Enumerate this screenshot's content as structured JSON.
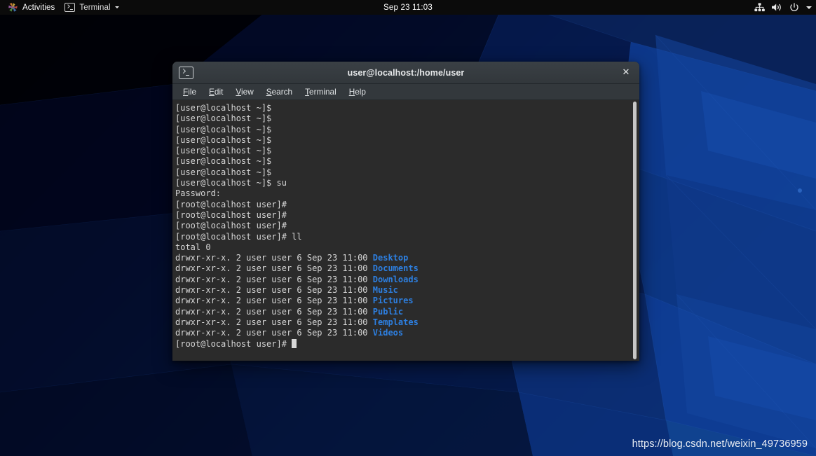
{
  "topbar": {
    "activities_label": "Activities",
    "activities_icon": "pinwheel-icon",
    "app_menu_label": "Terminal",
    "app_menu_icon": "terminal-icon",
    "app_menu_caret": "chevron-down-icon",
    "clock": "Sep 23  11:03",
    "status_icons": [
      "network-wired-icon",
      "volume-icon",
      "power-icon",
      "chevron-down-icon"
    ],
    "background_color": "#0b0b0b"
  },
  "window": {
    "title": "user@localhost:/home/user",
    "icon": "terminal-icon",
    "close_label": "✕",
    "titlebar_color": "#32373b",
    "menu": [
      {
        "label": "File",
        "mnemonic": "F",
        "rest": "ile"
      },
      {
        "label": "Edit",
        "mnemonic": "E",
        "rest": "dit"
      },
      {
        "label": "View",
        "mnemonic": "V",
        "rest": "iew"
      },
      {
        "label": "Search",
        "mnemonic": "S",
        "rest": "earch"
      },
      {
        "label": "Terminal",
        "mnemonic": "T",
        "rest": "erminal"
      },
      {
        "label": "Help",
        "mnemonic": "H",
        "rest": "elp"
      }
    ]
  },
  "terminal": {
    "background_color": "#2b2b2b",
    "foreground_color": "#d6d6d6",
    "directory_color": "#2d7fe0",
    "user_prompt": "[user@localhost ~]$",
    "root_prompt": "[root@localhost user]#",
    "lines": [
      {
        "type": "prompt",
        "prompt": "[user@localhost ~]$",
        "command": ""
      },
      {
        "type": "prompt",
        "prompt": "[user@localhost ~]$",
        "command": ""
      },
      {
        "type": "prompt",
        "prompt": "[user@localhost ~]$",
        "command": ""
      },
      {
        "type": "prompt",
        "prompt": "[user@localhost ~]$",
        "command": ""
      },
      {
        "type": "prompt",
        "prompt": "[user@localhost ~]$",
        "command": ""
      },
      {
        "type": "prompt",
        "prompt": "[user@localhost ~]$",
        "command": ""
      },
      {
        "type": "prompt",
        "prompt": "[user@localhost ~]$",
        "command": ""
      },
      {
        "type": "prompt",
        "prompt": "[user@localhost ~]$",
        "command": " su"
      },
      {
        "type": "output",
        "text": "Password:"
      },
      {
        "type": "prompt",
        "prompt": "[root@localhost user]#",
        "command": ""
      },
      {
        "type": "prompt",
        "prompt": "[root@localhost user]#",
        "command": ""
      },
      {
        "type": "prompt",
        "prompt": "[root@localhost user]#",
        "command": ""
      },
      {
        "type": "prompt",
        "prompt": "[root@localhost user]#",
        "command": " ll"
      },
      {
        "type": "output",
        "text": "total 0"
      },
      {
        "type": "listing",
        "text": "drwxr-xr-x. 2 user user 6 Sep 23 11:00 ",
        "name": "Desktop"
      },
      {
        "type": "listing",
        "text": "drwxr-xr-x. 2 user user 6 Sep 23 11:00 ",
        "name": "Documents"
      },
      {
        "type": "listing",
        "text": "drwxr-xr-x. 2 user user 6 Sep 23 11:00 ",
        "name": "Downloads"
      },
      {
        "type": "listing",
        "text": "drwxr-xr-x. 2 user user 6 Sep 23 11:00 ",
        "name": "Music"
      },
      {
        "type": "listing",
        "text": "drwxr-xr-x. 2 user user 6 Sep 23 11:00 ",
        "name": "Pictures"
      },
      {
        "type": "listing",
        "text": "drwxr-xr-x. 2 user user 6 Sep 23 11:00 ",
        "name": "Public"
      },
      {
        "type": "listing",
        "text": "drwxr-xr-x. 2 user user 6 Sep 23 11:00 ",
        "name": "Templates"
      },
      {
        "type": "listing",
        "text": "drwxr-xr-x. 2 user user 6 Sep 23 11:00 ",
        "name": "Videos"
      },
      {
        "type": "cursor",
        "prompt": "[root@localhost user]#",
        "command": " "
      }
    ]
  },
  "watermark": {
    "text": "https://blog.csdn.net/weixin_49736959"
  },
  "desktop": {
    "background_base": "#041136"
  }
}
